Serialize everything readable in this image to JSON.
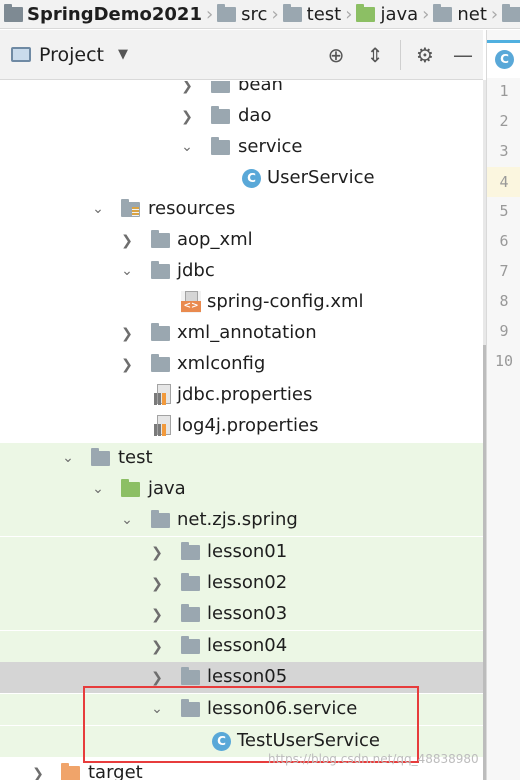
{
  "breadcrumb": {
    "project": "SpringDemo2021",
    "items": [
      "src",
      "test",
      "java",
      "net"
    ]
  },
  "project_panel": {
    "title": "Project",
    "dropdown_icon": "triangle-down-icon",
    "actions": [
      "locate-icon",
      "collapse-all-icon",
      "gear-icon",
      "minimize-icon"
    ]
  },
  "tree": {
    "rows": [
      {
        "label": "bean",
        "icon": "package-icon"
      },
      {
        "label": "dao",
        "icon": "package-icon"
      },
      {
        "label": "service",
        "icon": "package-icon"
      },
      {
        "label": "UserService",
        "icon": "class-icon"
      },
      {
        "label": "resources",
        "icon": "resources-folder-icon"
      },
      {
        "label": "aop_xml",
        "icon": "folder-icon"
      },
      {
        "label": "jdbc",
        "icon": "folder-icon"
      },
      {
        "label": "spring-config.xml",
        "icon": "xml-file-icon"
      },
      {
        "label": "xml_annotation",
        "icon": "folder-icon"
      },
      {
        "label": "xmlconfig",
        "icon": "folder-icon"
      },
      {
        "label": "jdbc.properties",
        "icon": "properties-file-icon"
      },
      {
        "label": "log4j.properties",
        "icon": "properties-file-icon"
      },
      {
        "label": "test",
        "icon": "folder-icon"
      },
      {
        "label": "java",
        "icon": "test-source-folder-icon"
      },
      {
        "label": "net.zjs.spring",
        "icon": "package-icon"
      },
      {
        "label": "lesson01",
        "icon": "package-icon"
      },
      {
        "label": "lesson02",
        "icon": "package-icon"
      },
      {
        "label": "lesson03",
        "icon": "package-icon"
      },
      {
        "label": "lesson04",
        "icon": "package-icon"
      },
      {
        "label": "lesson05",
        "icon": "package-icon"
      },
      {
        "label": "lesson06.service",
        "icon": "package-icon"
      },
      {
        "label": "TestUserService",
        "icon": "class-icon"
      },
      {
        "label": "target",
        "icon": "excluded-folder-icon"
      }
    ]
  },
  "editor": {
    "tab_icon": "C",
    "line_numbers": [
      "1",
      "2",
      "3",
      "4",
      "5",
      "6",
      "7",
      "8",
      "9",
      "10"
    ],
    "current_line": "4"
  },
  "class_glyph": "C",
  "xml_glyph": "<>",
  "watermark": "https://blog.csdn.net/qq_48838980",
  "colors": {
    "test_tint": "#ecf7e5",
    "selection": "#d5d5d5",
    "highlight_box": "#e73c3c",
    "class_icon": "#59a8d8"
  }
}
